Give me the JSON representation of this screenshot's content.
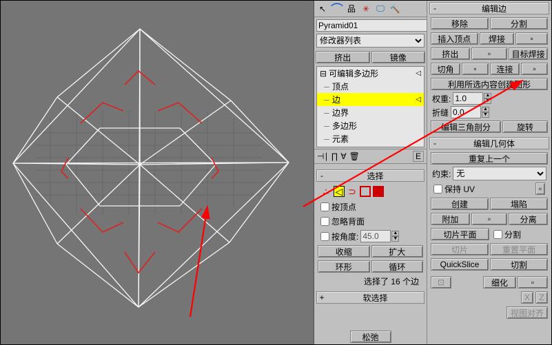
{
  "object_name": "Pyramid01",
  "modifier_dropdown": "修改器列表",
  "extrude_btn": "挤出",
  "mirror_btn": "镜像",
  "tree": {
    "root": "可编辑多边形",
    "vertex": "顶点",
    "edge": "边",
    "border": "边界",
    "polygon": "多边形",
    "element": "元素"
  },
  "sel_rollout": "选择",
  "by_vertex": "按顶点",
  "ignore_backface": "忽略背面",
  "by_angle": "按角度:",
  "by_angle_val": "45.0",
  "shrink": "收缩",
  "grow": "扩大",
  "ring": "环形",
  "loop": "循环",
  "status_text": "选择了 16 个边",
  "soft_sel": "软选择",
  "relax": "松弛",
  "edit_edge": "编辑边",
  "remove": "移除",
  "split": "分割",
  "insert_vertex": "插入顶点",
  "weld": "焊接",
  "extrude2": "挤出",
  "target_weld": "目标焊接",
  "chamfer": "切角",
  "connect": "连接",
  "create_shape": "利用所选内容创建图形",
  "weight_lbl": "权重:",
  "weight_val": "1.0",
  "crease_lbl": "折缝",
  "crease_val": "0.0",
  "edit_tri": "编辑三角剖分",
  "rotate": "旋转",
  "edit_geom": "编辑几何体",
  "repeat_last": "重复上一个",
  "constraint_lbl": "约束:",
  "constraint_val": "无",
  "preserve_uv": "保持 UV",
  "create": "创建",
  "collapse": "塌陷",
  "attach": "附加",
  "detach": "分离",
  "slice_plane": "切片平面",
  "split2": "分割",
  "slice": "切片",
  "reset_plane": "重置平面",
  "quickslice": "QuickSlice",
  "cut": "切割",
  "subdivide": "细化",
  "align_x": "X",
  "align_z": "Z",
  "align_view": "视图对齐"
}
